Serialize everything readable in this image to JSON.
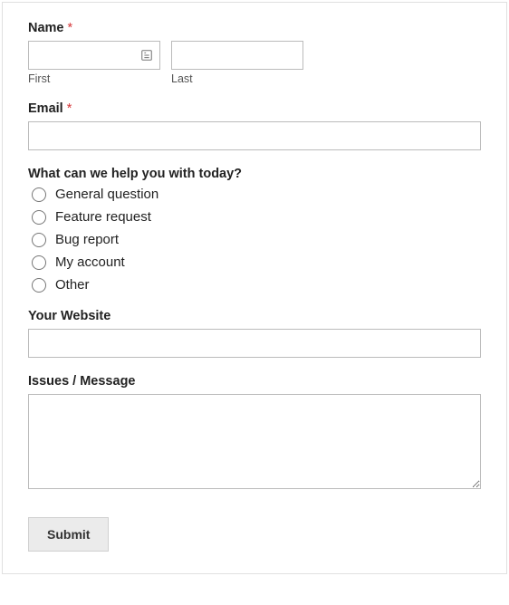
{
  "name": {
    "label": "Name",
    "required": "*",
    "first": {
      "value": "",
      "sublabel": "First"
    },
    "last": {
      "value": "",
      "sublabel": "Last"
    }
  },
  "email": {
    "label": "Email",
    "required": "*",
    "value": ""
  },
  "help_topic": {
    "label": "What can we help you with today?",
    "options": [
      "General question",
      "Feature request",
      "Bug report",
      "My account",
      "Other"
    ]
  },
  "website": {
    "label": "Your Website",
    "value": ""
  },
  "message": {
    "label": "Issues / Message",
    "value": ""
  },
  "submit": {
    "label": "Submit"
  }
}
